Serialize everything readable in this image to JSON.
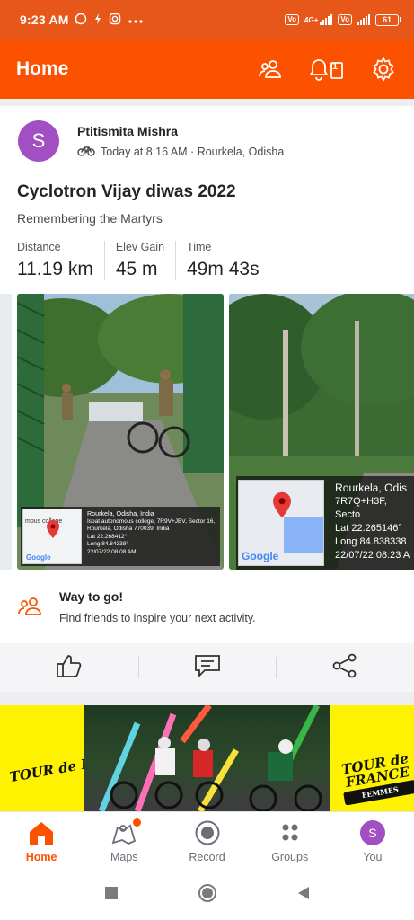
{
  "status_bar": {
    "time": "9:23 AM",
    "indicators": [
      "whatsapp-icon",
      "flash-icon",
      "instagram-icon",
      "more-dots-icon"
    ],
    "battery": "61",
    "network": "4G+"
  },
  "header": {
    "title": "Home",
    "actions": [
      "friends-icon",
      "notifications-icon",
      "settings-icon"
    ],
    "notification_count": "1"
  },
  "activity": {
    "athlete": {
      "initial": "S",
      "name": "Ptitismita Mishra",
      "time_place": "Today at 8:16 AM · Rourkela, Odisha"
    },
    "title": "Cyclotron Vijay diwas 2022",
    "description": "Remembering the Martyrs",
    "stats": [
      {
        "label": "Distance",
        "value": "11.19 km"
      },
      {
        "label": "Elev Gain",
        "value": "45 m"
      },
      {
        "label": "Time",
        "value": "49m 43s"
      }
    ],
    "photos": [
      {
        "place": "Rourkela, Odisha, India",
        "address": "Ispat autonomous college, 7R9V+JBV, Sector 16,",
        "address2": "Rourkela, Odisha 770039, India",
        "lat": "Lat 22.268412°",
        "long": "Long 84.84338°",
        "datetime": "22/07/22 08:08 AM",
        "map_label": "Google",
        "map_place": "mous college"
      },
      {
        "place": "Rourkela, Odis",
        "address": "7R7Q+H3F, Secto",
        "lat": "Lat 22.265146°",
        "long": "Long 84.838338",
        "datetime": "22/07/22 08:23 A",
        "map_label": "Google"
      }
    ]
  },
  "way_to_go": {
    "heading": "Way to go!",
    "text": "Find friends to inspire your next activity."
  },
  "action_bar": [
    "like-icon",
    "comment-icon",
    "share-icon"
  ],
  "promo": {
    "left_logo": "TOUR de FRANCE",
    "right_logo": "TOUR de FRANCE",
    "right_tag": "FEMMES"
  },
  "bottom_nav": {
    "tabs": [
      {
        "label": "Home",
        "icon": "home-icon",
        "active": true
      },
      {
        "label": "Maps",
        "icon": "maps-icon",
        "active": false
      },
      {
        "label": "Record",
        "icon": "record-icon",
        "active": false
      },
      {
        "label": "Groups",
        "icon": "groups-icon",
        "active": false
      },
      {
        "label": "You",
        "icon": "profile-avatar",
        "active": false
      }
    ],
    "you_initial": "S"
  },
  "colors": {
    "brand": "#fc5200",
    "status_bar": "#e8571a",
    "avatar": "#a24fc4",
    "promo_yellow": "#fff200"
  }
}
